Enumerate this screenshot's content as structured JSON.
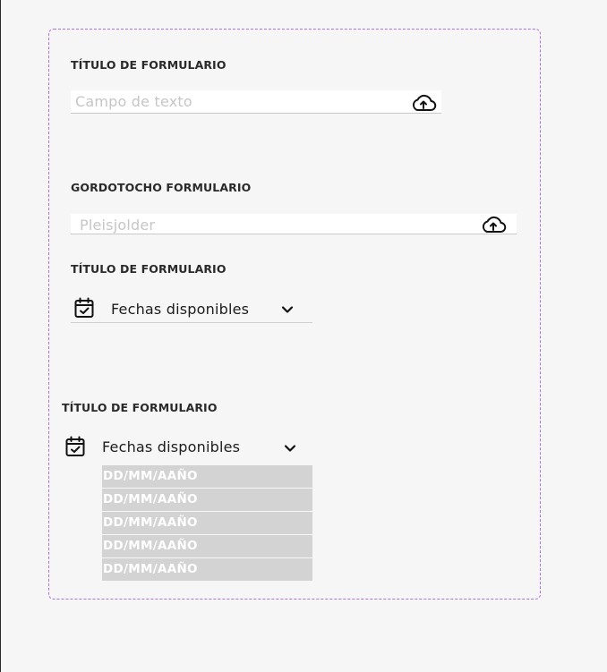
{
  "forms": {
    "upload_one": {
      "label": "TÍTULO DE FORMULARIO",
      "placeholder": "Campo de texto",
      "icon": "cloud-upload-icon"
    },
    "upload_two": {
      "label": "GORDOTOCHO FORMULARIO",
      "placeholder": "Pleisjolder",
      "icon": "cloud-upload-icon"
    },
    "date_collapsed": {
      "label": "TÍTULO DE FORMULARIO",
      "selected": "Fechas disponibles",
      "icon": "calendar-check-icon"
    },
    "date_expanded": {
      "label": "TÍTULO DE FORMULARIO",
      "selected": "Fechas disponibles",
      "icon": "calendar-check-icon",
      "options": [
        "DD/MM/AAÑO",
        "DD/MM/AAÑO",
        "DD/MM/AAÑO",
        "DD/MM/AAÑO",
        "DD/MM/AAÑO"
      ]
    }
  },
  "colors": {
    "background": "#f6f6f6",
    "frame_border": "#b06fe0",
    "field_bg": "#ffffff",
    "placeholder": "#c6c6c6",
    "option_bg": "#d3d3d3",
    "option_text": "#ffffff"
  }
}
